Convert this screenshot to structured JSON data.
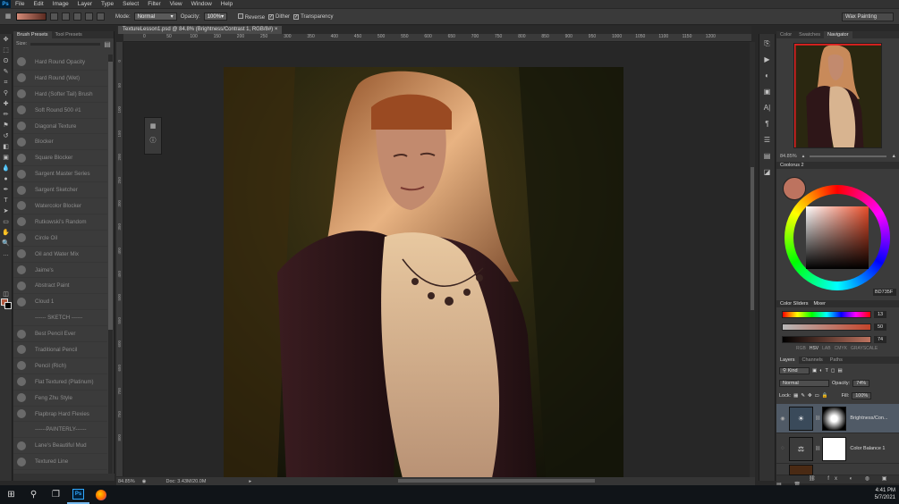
{
  "app": {
    "logo": "Ps",
    "menu": [
      "File",
      "Edit",
      "Image",
      "Layer",
      "Type",
      "Select",
      "Filter",
      "View",
      "Window",
      "Help"
    ]
  },
  "options_bar": {
    "mode_label": "Mode:",
    "mode_value": "Normal",
    "opacity_label": "Opacity:",
    "opacity_value": "100%",
    "reverse_label": "Reverse",
    "dither_label": "Dither",
    "transparency_label": "Transparency",
    "workspace": "Wax Painting"
  },
  "brush_presets": {
    "tabs": [
      "Brush Presets",
      "Tool Presets"
    ],
    "size_label": "Size:",
    "items": [
      "Hard Round Opacity",
      "Hard Round (Wet)",
      "Hard (Softer Tail) Brush",
      "Soft Round 500 #1",
      "Diagonal Texture",
      "Blocker",
      "Square Blocker",
      "Sargent Master Series",
      "Sargent Sketcher",
      "Watercolor Blocker",
      "Rutkowski's Random",
      "Circle Oil",
      "Oil and Water Mix",
      "Jaime's",
      "Abstract Paint",
      "Cloud 1",
      "------ SKETCH ------",
      "Best Pencil Ever",
      "Traditional Pencil",
      "Pencil (Rich)",
      "Flat Textured (Platinum)",
      "Feng Zhu Style",
      "Flapbrap Hard Flexies",
      "------PAINTERLY------",
      "Lane's Beautiful Mud",
      "Textured Line"
    ]
  },
  "document": {
    "tab_title": "TextureLesson1.psd @ 84.8% (Brightness/Contrast 1, RGB/8#)",
    "ruler_ticks": [
      "0",
      "50",
      "100",
      "150",
      "200",
      "250",
      "300",
      "350",
      "400",
      "450",
      "500",
      "550",
      "600",
      "650",
      "700",
      "750",
      "800",
      "850",
      "900",
      "950",
      "1000",
      "1050",
      "1100",
      "1150",
      "1200"
    ],
    "ruler_v_ticks": [
      "0",
      "50",
      "100",
      "150",
      "200",
      "250",
      "300",
      "350",
      "400",
      "450",
      "500",
      "550",
      "600",
      "650",
      "700",
      "750",
      "800"
    ],
    "zoom": "84.85%",
    "doc_info": "Doc: 3.43M/20.0M"
  },
  "right_panels": {
    "top_tabs": [
      "Color",
      "Swatches",
      "Navigator"
    ],
    "nav_zoom": "84.85%",
    "coolorus_title": "Coolorus 2",
    "hex": "BD735F",
    "sliders_tabs": [
      "Color Sliders",
      "Mixer"
    ],
    "slider_values": [
      "13",
      "50",
      "74"
    ],
    "modes": [
      "RGB",
      "HSV",
      "LAB",
      "CMYK",
      "GRAYSCALE"
    ],
    "active_mode": "HSV",
    "layers_tabs": [
      "Layers",
      "Channels",
      "Paths"
    ],
    "kind_label": "Kind",
    "blend_mode": "Normal",
    "opacity_label": "Opacity:",
    "opacity_value": "74%",
    "lock_label": "Lock:",
    "fill_label": "Fill:",
    "fill_value": "100%",
    "layers": [
      {
        "name": "Brightness/Con...",
        "selected": true
      },
      {
        "name": "Color Balance 1",
        "selected": false
      }
    ]
  },
  "taskbar": {
    "ps_label": "Ps",
    "time": "4:41 PM",
    "date": "5/7/2021"
  },
  "colors": {
    "foreground": "#bd735f",
    "accent": "#31a8ff"
  }
}
